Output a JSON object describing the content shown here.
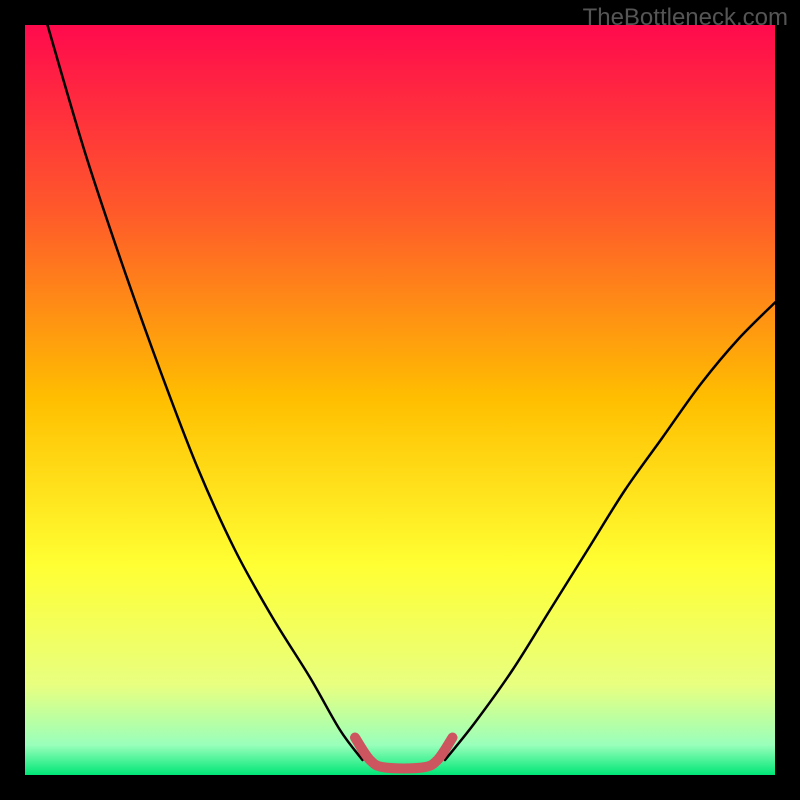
{
  "watermark": "TheBottleneck.com",
  "chart_data": {
    "type": "line",
    "title": "",
    "xlabel": "",
    "ylabel": "",
    "xlim": [
      0,
      100
    ],
    "ylim": [
      0,
      100
    ],
    "gradient_stops": [
      {
        "offset": 0,
        "color": "#ff0a4d"
      },
      {
        "offset": 0.25,
        "color": "#ff5a2a"
      },
      {
        "offset": 0.5,
        "color": "#ffbf00"
      },
      {
        "offset": 0.72,
        "color": "#ffff33"
      },
      {
        "offset": 0.88,
        "color": "#e8ff80"
      },
      {
        "offset": 0.96,
        "color": "#99ffbb"
      },
      {
        "offset": 1.0,
        "color": "#00e676"
      }
    ],
    "series": [
      {
        "name": "left-curve",
        "stroke": "#000000",
        "x": [
          3,
          8,
          13,
          18,
          23,
          28,
          33,
          38,
          42,
          45
        ],
        "y": [
          100,
          83,
          68,
          54,
          41,
          30,
          21,
          13,
          6,
          2
        ]
      },
      {
        "name": "right-curve",
        "stroke": "#000000",
        "x": [
          56,
          60,
          65,
          70,
          75,
          80,
          85,
          90,
          95,
          100
        ],
        "y": [
          2,
          7,
          14,
          22,
          30,
          38,
          45,
          52,
          58,
          63
        ]
      },
      {
        "name": "trough",
        "stroke": "#cc5560",
        "stroke_width": 10,
        "x": [
          44,
          46,
          48,
          53,
          55,
          57
        ],
        "y": [
          5,
          2,
          1,
          1,
          2,
          5
        ]
      }
    ]
  }
}
